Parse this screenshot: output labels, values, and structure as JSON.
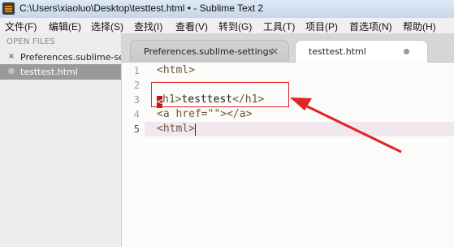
{
  "window": {
    "title": "C:\\Users\\xiaoluo\\Desktop\\testtest.html • - Sublime Text 2"
  },
  "menu": [
    "文件(F)",
    "编辑(E)",
    "选择(S)",
    "查找(I)",
    "查看(V)",
    "转到(G)",
    "工具(T)",
    "项目(P)",
    "首选项(N)",
    "帮助(H)"
  ],
  "sidebar": {
    "heading": "OPEN FILES",
    "files": [
      {
        "name": "Preferences.sublime-settings",
        "marker": "×",
        "active": false
      },
      {
        "name": "testtest.html",
        "marker": "●",
        "active": true
      }
    ]
  },
  "tabs": [
    {
      "label": "Preferences.sublime-settings",
      "close": "×",
      "active": false
    },
    {
      "label": "testtest.html",
      "close": "●",
      "active": true
    }
  ],
  "editor": {
    "line_numbers": [
      "1",
      "2",
      "3",
      "4",
      "5"
    ],
    "current_line": 5,
    "lines": [
      "<html>",
      "",
      "<h1>testtest</h1>",
      "<a href=\"\"></a>",
      "<html>"
    ],
    "line3_parts": {
      "first": "<",
      "tag_open": "h1>",
      "text": "testtest",
      "tag_close": "</h1>"
    },
    "line4_parts": {
      "a": "<a href=",
      "str": "\"\"",
      "b": "></a>"
    }
  },
  "annotation": {
    "color": "#e02424"
  },
  "colors": {
    "tag": "#6e5636",
    "string": "#3b7a1a",
    "cursor_block": "#c41616",
    "current_line": "#f1e8ef"
  }
}
